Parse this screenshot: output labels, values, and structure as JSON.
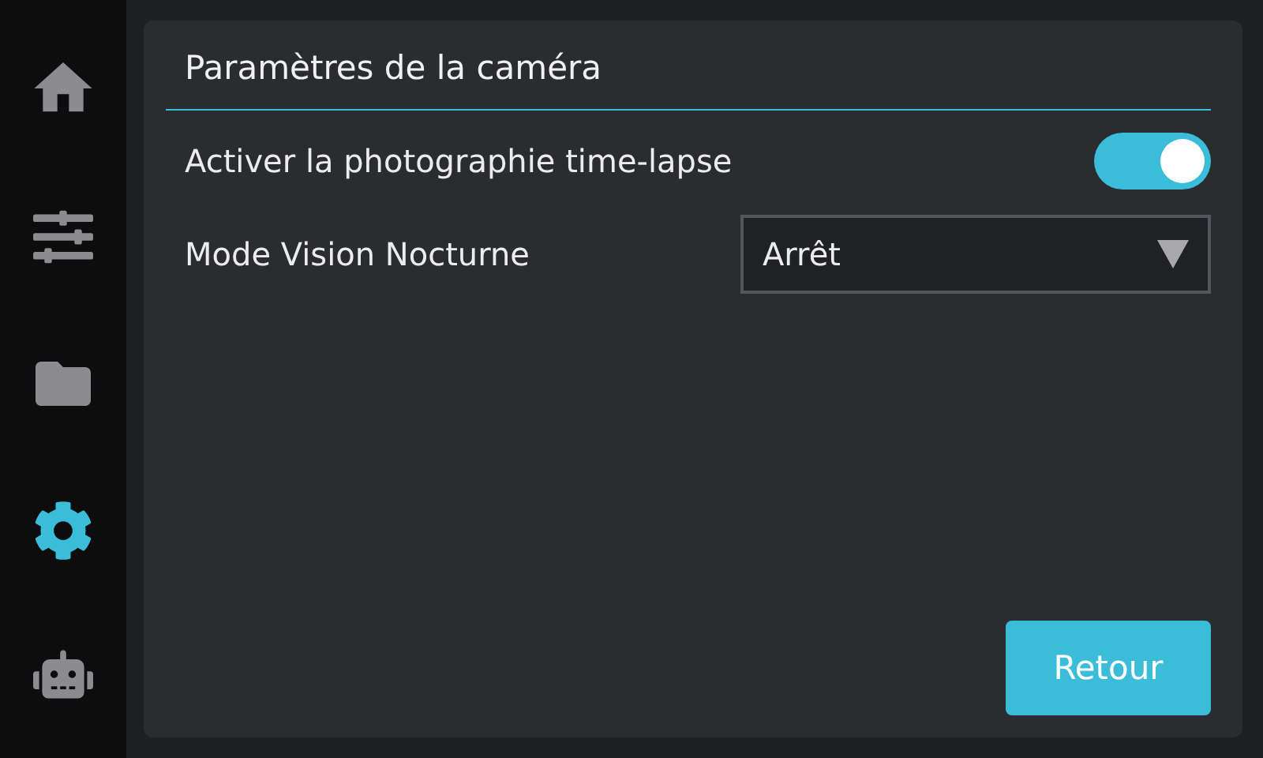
{
  "sidebar": {
    "items": [
      {
        "kind": "home",
        "selected": false
      },
      {
        "kind": "sliders",
        "selected": false
      },
      {
        "kind": "folder",
        "selected": false
      },
      {
        "kind": "settings",
        "selected": true
      },
      {
        "kind": "robot",
        "selected": false
      }
    ]
  },
  "panel": {
    "title": "Paramètres de la caméra",
    "settings": [
      {
        "kind": "toggle",
        "label": "Activer la photographie time-lapse",
        "on": true
      },
      {
        "kind": "dropdown",
        "label": "Mode Vision Nocturne",
        "value": "Arrêt"
      }
    ],
    "back_button": "Retour"
  }
}
